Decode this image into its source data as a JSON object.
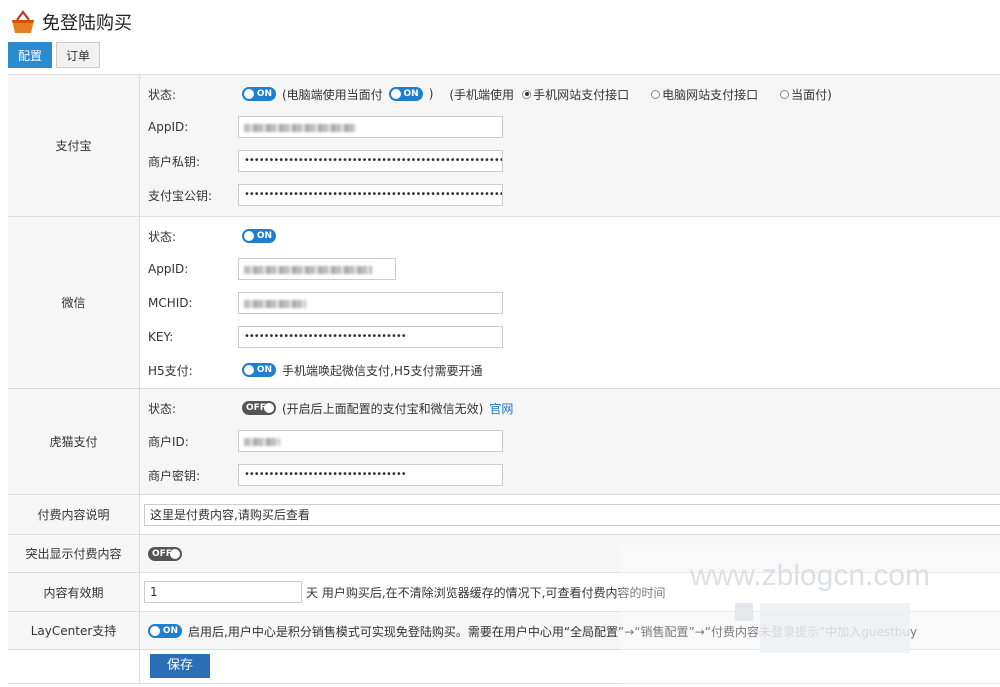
{
  "page": {
    "title": "免登陆购买"
  },
  "tabs": [
    {
      "label": "配置"
    },
    {
      "label": "订单"
    }
  ],
  "alipay": {
    "label": "支付宝",
    "status_label": "状态:",
    "status_toggle": "ON",
    "pc_note_open": "(电脑端使用当面付",
    "pc_toggle": "ON",
    "pc_note_close": ")",
    "mobile_note": "(手机端使用",
    "radio_mobile": "手机网站支付接口",
    "radio_pc": "电脑网站支付接口",
    "radio_face": "当面付)",
    "appid_label": "AppID:",
    "appid_value": "",
    "private_key_label": "商户私钥:",
    "private_key_value": "•••••••••••••••••••••••••••••••••••••••••••••••••••••••••••••••••••",
    "public_key_label": "支付宝公钥:",
    "public_key_value": "•••••••••••••••••••••••••••••••••••••••••••••••••••••••••••••••••••"
  },
  "wechat": {
    "label": "微信",
    "status_label": "状态:",
    "status_toggle": "ON",
    "appid_label": "AppID:",
    "mchid_label": "MCHID:",
    "key_label": "KEY:",
    "key_value": "•••••••••••••••••••••••••••••••••",
    "h5_label": "H5支付:",
    "h5_toggle": "ON",
    "h5_note": "手机端唤起微信支付,H5支付需要开通"
  },
  "xunhu": {
    "label": "虎猫支付",
    "status_label": "状态:",
    "status_toggle": "OFF",
    "status_note": "(开启后上面配置的支付宝和微信无效)",
    "site_link": "官网",
    "merchant_id_label": "商户ID:",
    "merchant_key_label": "商户密钥:",
    "merchant_key_value": "•••••••••••••••••••••••••••••••••"
  },
  "paid_desc": {
    "label": "付费内容说明",
    "value": "这里是付费内容,请购买后查看"
  },
  "highlight": {
    "label": "突出显示付费内容",
    "toggle": "OFF"
  },
  "validity": {
    "label": "内容有效期",
    "value": "1",
    "note": "天 用户购买后,在不清除浏览器缓存的情况下,可查看付费内容的时间"
  },
  "laycenter": {
    "label": "LayCenter支持",
    "toggle": "ON",
    "note": "启用后,用户中心是积分销售模式可实现免登陆购买。需要在用户中心用“全局配置”→“销售配置”→“付费内容未登录提示”中加入guestbuy"
  },
  "save_button": "保存",
  "watermark_text": "www.zblogcn.com"
}
